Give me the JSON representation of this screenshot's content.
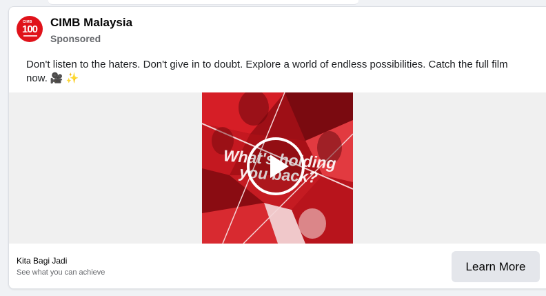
{
  "post": {
    "page_name": "CIMB Malaysia",
    "sponsored_label": "Sponsored",
    "avatar": {
      "logo_brand": "CIMB",
      "logo_number": "100",
      "color": "#e0121a"
    },
    "caption": "Don't listen to the haters. Don't give in to doubt. Explore a world of endless possibilities. Catch the full film now.",
    "caption_emojis": [
      "🎥",
      "✨"
    ]
  },
  "video": {
    "overlay_text_line1": "What's holding",
    "overlay_text_line2": "you back?",
    "play_icon": "play-icon",
    "accent_color": "#c8141c"
  },
  "cta": {
    "headline": "Kita Bagi Jadi",
    "description": "See what you can achieve",
    "button_label": "Learn More"
  }
}
